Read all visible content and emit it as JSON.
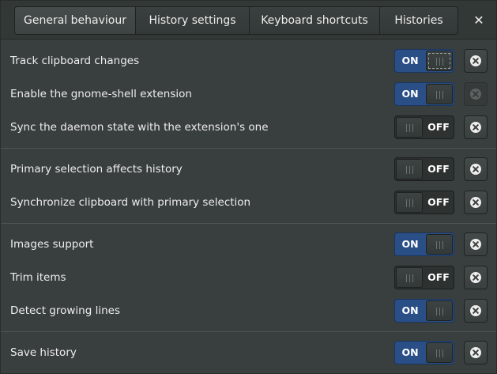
{
  "tabs": [
    {
      "label": "General behaviour",
      "active": true
    },
    {
      "label": "History settings",
      "active": false
    },
    {
      "label": "Keyboard shortcuts",
      "active": false
    },
    {
      "label": "Histories",
      "active": false
    }
  ],
  "window": {
    "close_glyph": "✕"
  },
  "switch_labels": {
    "on": "ON",
    "off": "OFF"
  },
  "settings": [
    {
      "label": "Track clipboard changes",
      "state": "ON",
      "reset_enabled": true
    },
    {
      "label": "Enable the gnome-shell extension",
      "state": "ON",
      "reset_enabled": false
    },
    {
      "label": "Sync the daemon state with the extension's one",
      "state": "OFF",
      "reset_enabled": true
    },
    {
      "label": "Primary selection affects history",
      "state": "OFF",
      "reset_enabled": true
    },
    {
      "label": "Synchronize clipboard with primary selection",
      "state": "OFF",
      "reset_enabled": true
    },
    {
      "label": "Images support",
      "state": "ON",
      "reset_enabled": true
    },
    {
      "label": "Trim items",
      "state": "OFF",
      "reset_enabled": true
    },
    {
      "label": "Detect growing lines",
      "state": "ON",
      "reset_enabled": true
    },
    {
      "label": "Save history",
      "state": "ON",
      "reset_enabled": true
    }
  ],
  "colors": {
    "background": "#393f3f",
    "switch_on": "#2a4e86",
    "text": "#eeeeec"
  },
  "icons": {
    "reset": "clear-icon",
    "close": "close-icon"
  }
}
